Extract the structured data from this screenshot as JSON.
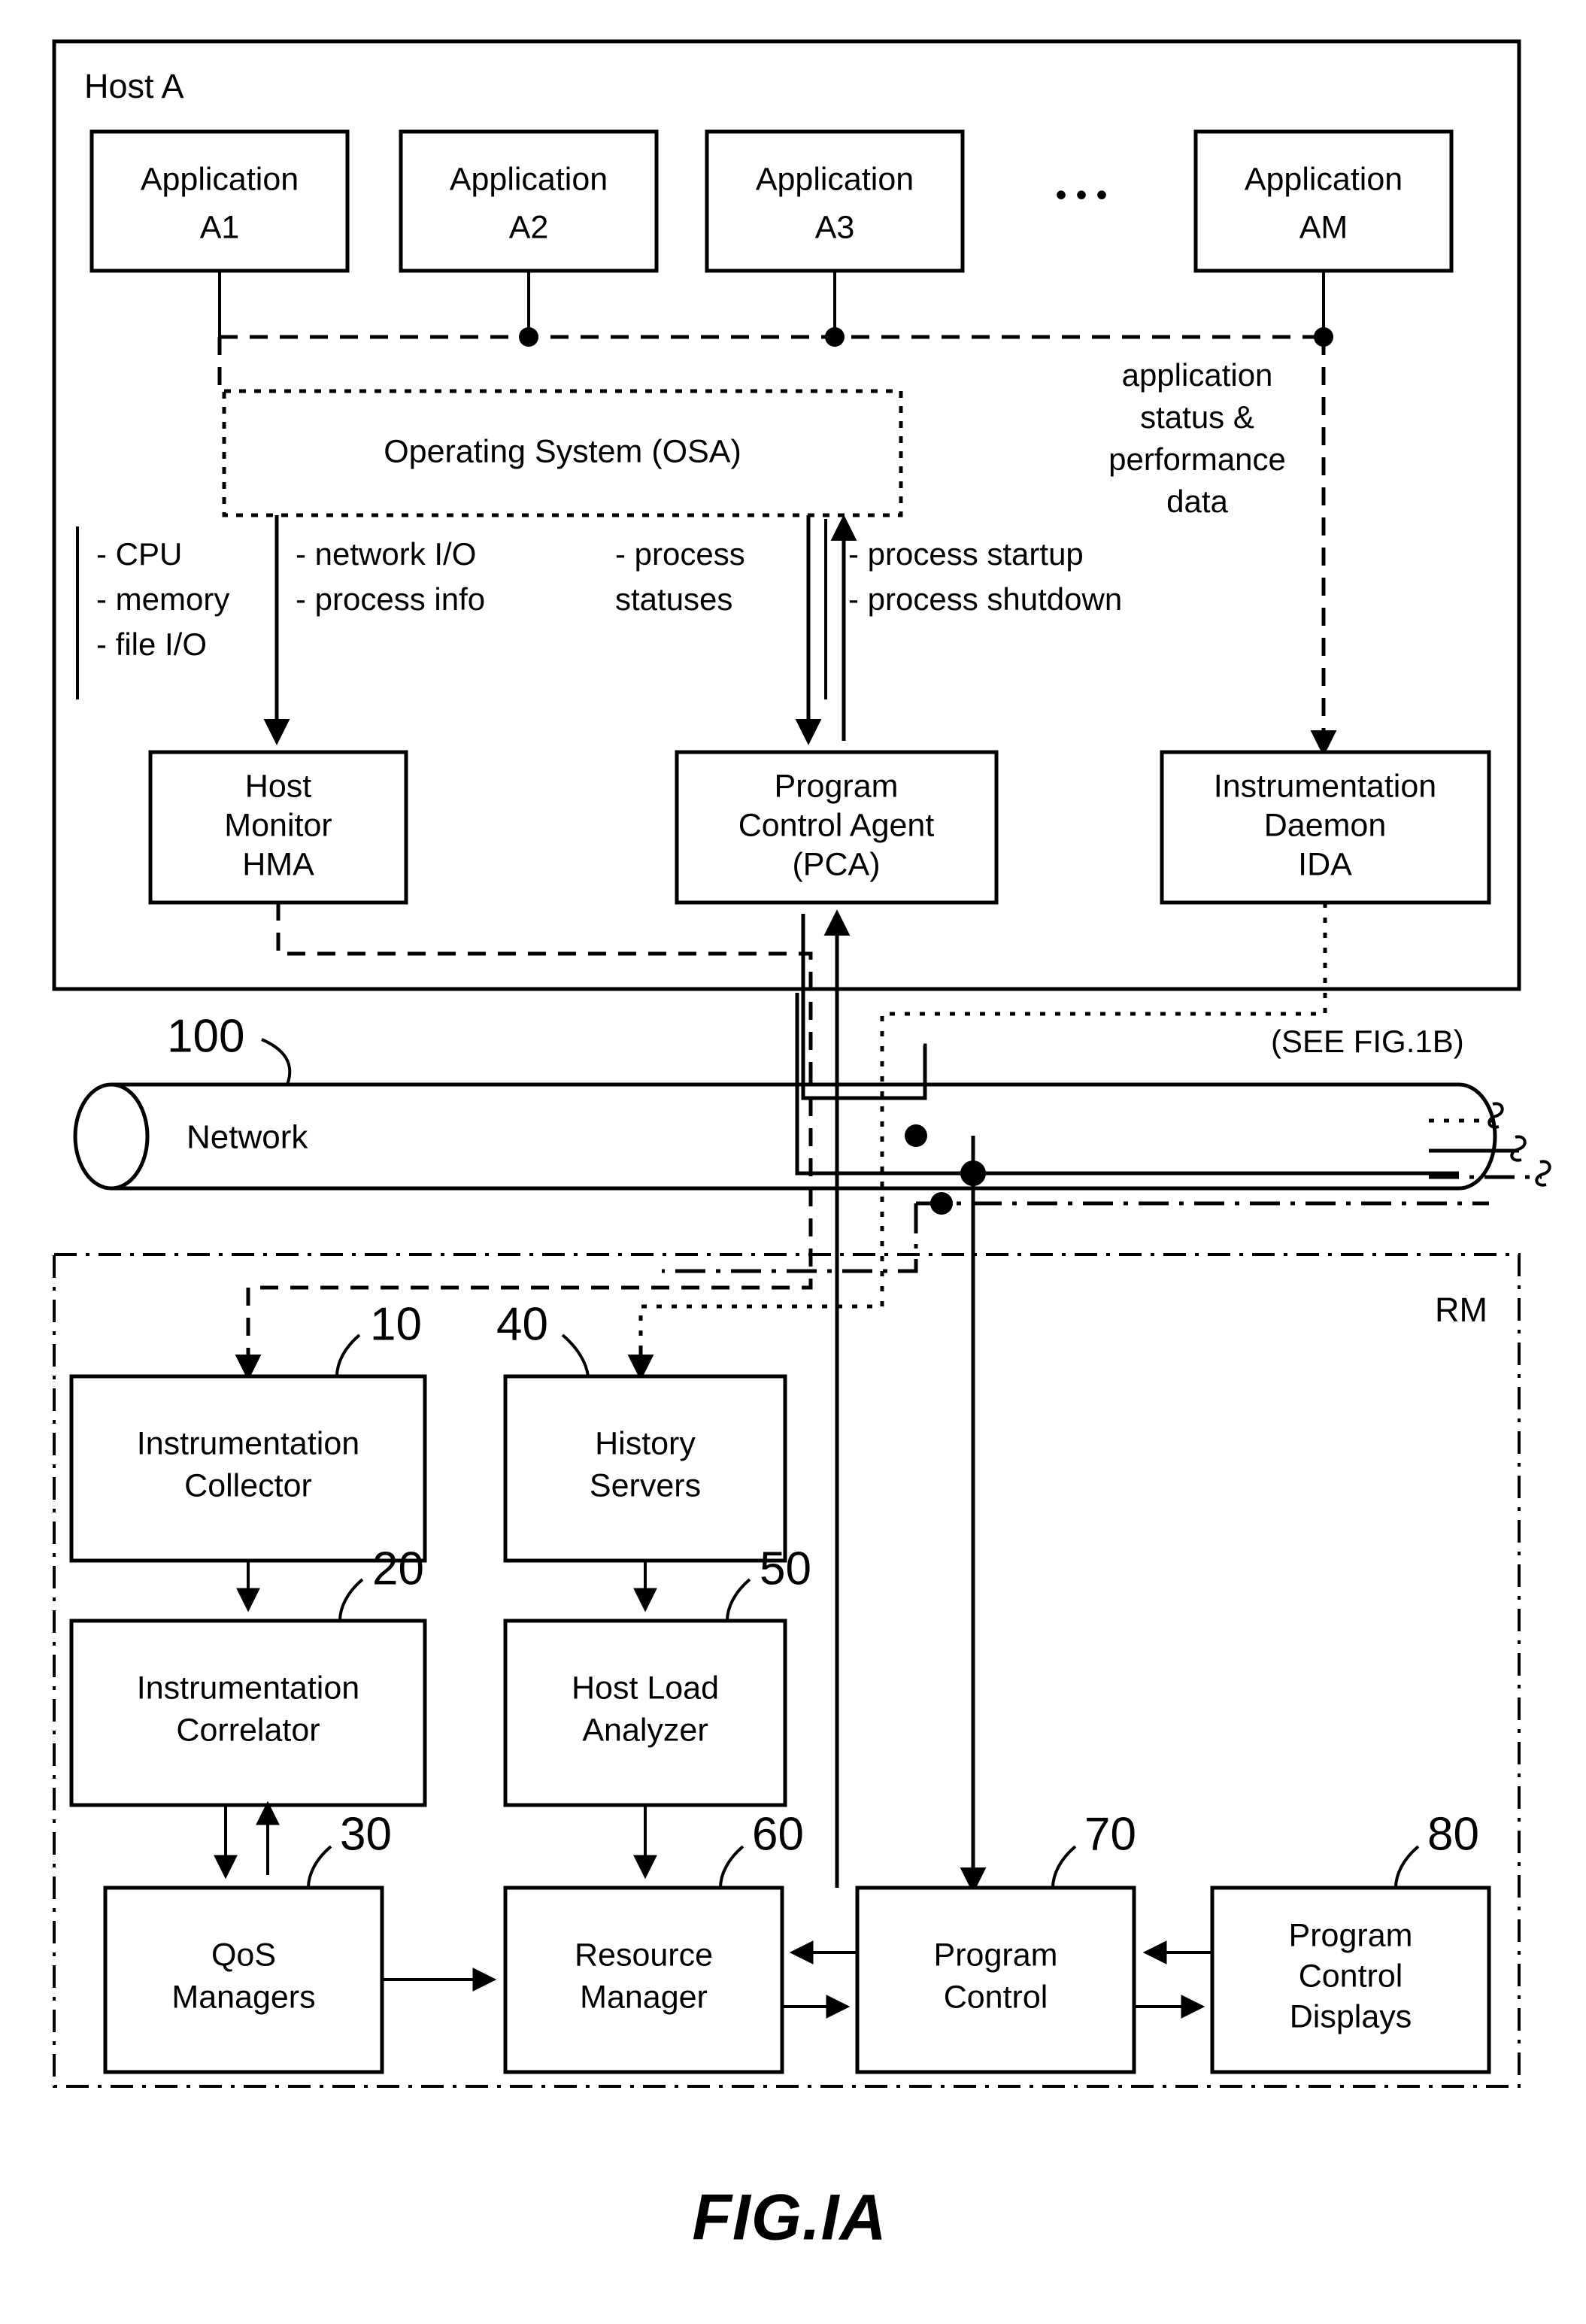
{
  "figure": {
    "caption": "FIG.IA",
    "host_panel": {
      "title": "Host A",
      "applications": [
        {
          "line1": "Application",
          "line2": "A1"
        },
        {
          "line1": "Application",
          "line2": "A2"
        },
        {
          "line1": "Application",
          "line2": "A3"
        },
        {
          "line1": "Application",
          "line2": "AM"
        }
      ],
      "ellipsis": "•  •  •",
      "os_box": {
        "label": "Operating System (OSA)"
      },
      "annotations": {
        "host_monitor_metrics": [
          "- CPU",
          "- memory",
          "- file I/O"
        ],
        "os_metrics": [
          "- network I/O",
          "- process info"
        ],
        "process_statuses": [
          "- process",
          "  statuses"
        ],
        "process_control": [
          "- process startup",
          "- process shutdown"
        ],
        "application_data": [
          "application",
          "status &",
          "performance",
          "data"
        ]
      },
      "agents": [
        {
          "lines": [
            "Host",
            "Monitor",
            "HMA"
          ]
        },
        {
          "lines": [
            "Program",
            "Control Agent",
            "(PCA)"
          ]
        },
        {
          "lines": [
            "Instrumentation",
            "Daemon",
            "IDA"
          ]
        }
      ]
    },
    "network": {
      "label": "Network",
      "ref": "100",
      "see_fig": "(SEE FIG.1B)"
    },
    "rm_panel": {
      "title": "RM",
      "nodes": [
        {
          "ref": "10",
          "lines": [
            "Instrumentation",
            "Collector"
          ]
        },
        {
          "ref": "40",
          "lines": [
            "History",
            "Servers"
          ]
        },
        {
          "ref": "20",
          "lines": [
            "Instrumentation",
            "Correlator"
          ]
        },
        {
          "ref": "50",
          "lines": [
            "Host Load",
            "Analyzer"
          ]
        },
        {
          "ref": "30",
          "lines": [
            "QoS",
            "Managers"
          ]
        },
        {
          "ref": "60",
          "lines": [
            "Resource",
            "Manager"
          ]
        },
        {
          "ref": "70",
          "lines": [
            "Program",
            "Control"
          ]
        },
        {
          "ref": "80",
          "lines": [
            "Program",
            "Control",
            "Displays"
          ]
        }
      ]
    }
  },
  "colors": {
    "ink": "#000000",
    "paper": "#ffffff"
  }
}
